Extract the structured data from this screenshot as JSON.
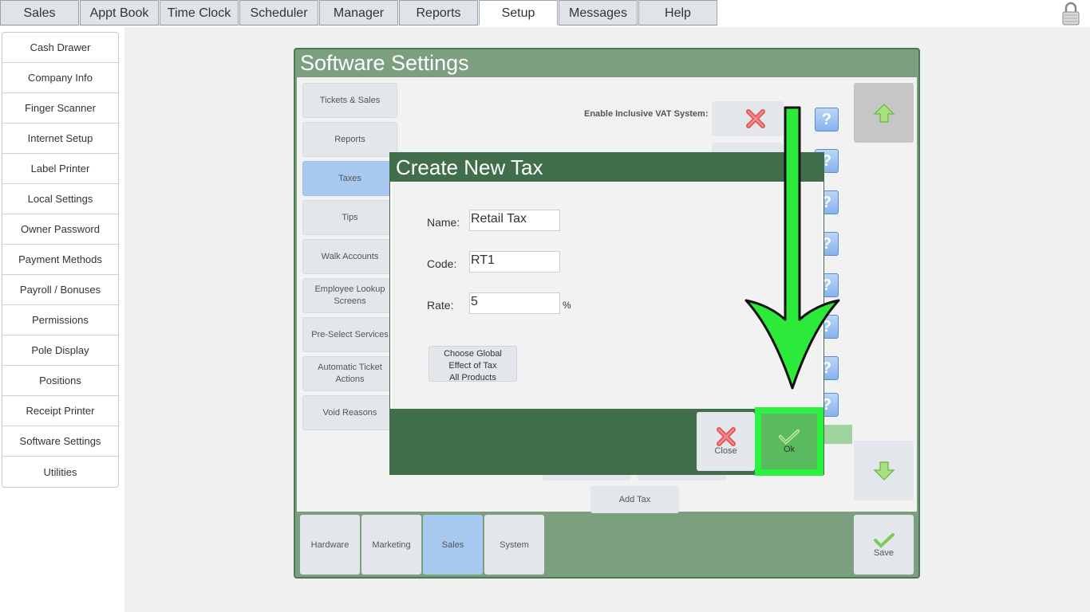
{
  "top_tabs": [
    "Sales",
    "Appt Book",
    "Time Clock",
    "Scheduler",
    "Manager",
    "Reports",
    "Setup",
    "Messages",
    "Help"
  ],
  "active_top_tab": "Setup",
  "sidebar": [
    "Cash Drawer",
    "Company Info",
    "Finger Scanner",
    "Internet Setup",
    "Label Printer",
    "Local Settings",
    "Owner Password",
    "Payment Methods",
    "Payroll / Bonuses",
    "Permissions",
    "Pole Display",
    "Positions",
    "Receipt Printer",
    "Software Settings",
    "Utilities"
  ],
  "panel": {
    "title": "Software Settings",
    "categories": [
      "Tickets & Sales",
      "Reports",
      "Taxes",
      "Tips",
      "Walk Accounts",
      "Employee Lookup Screens",
      "Pre-Select Services",
      "Automatic Ticket Actions",
      "Void Reasons"
    ],
    "active_category": "Taxes",
    "vat_label": "Enable Inclusive VAT System:",
    "help_glyph": "?",
    "add_tax_label": "Add Tax",
    "bottom_tabs": [
      "Hardware",
      "Marketing",
      "Sales",
      "System"
    ],
    "active_bottom_tab": "Sales",
    "save_label": "Save"
  },
  "dialog": {
    "title": "Create New Tax",
    "name_label": "Name:",
    "name_value": "Retail Tax",
    "code_label": "Code:",
    "code_value": "RT1",
    "rate_label": "Rate:",
    "rate_value": "5",
    "percent_sign": "%",
    "global_button": {
      "line1": "Choose Global",
      "line2": "Effect of Tax",
      "line3": "All Products"
    },
    "close_label": "Close",
    "ok_label": "Ok"
  },
  "colors": {
    "header_green": "#426f4b",
    "panel_green": "#7b9f7f",
    "active_blue": "#a7c9f0",
    "highlight_green": "#2af23e"
  }
}
